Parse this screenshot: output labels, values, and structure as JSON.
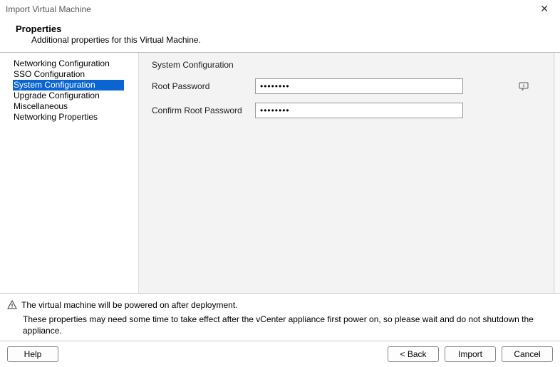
{
  "window": {
    "title": "Import Virtual Machine"
  },
  "header": {
    "title": "Properties",
    "subtitle": "Additional properties for this Virtual Machine."
  },
  "sidebar": {
    "items": [
      {
        "label": "Networking Configuration",
        "selected": false
      },
      {
        "label": "SSO Configuration",
        "selected": false
      },
      {
        "label": "System Configuration",
        "selected": true
      },
      {
        "label": "Upgrade Configuration",
        "selected": false
      },
      {
        "label": "Miscellaneous",
        "selected": false
      },
      {
        "label": "Networking Properties",
        "selected": false
      }
    ]
  },
  "content": {
    "section_title": "System Configuration",
    "root_password_label": "Root Password",
    "root_password_value": "••••••••",
    "confirm_root_password_label": "Confirm Root Password",
    "confirm_root_password_value": "••••••••"
  },
  "notice": {
    "line1": "The virtual machine will be powered on after deployment.",
    "line2": "These properties may need some time to take effect after the vCenter appliance first power on, so please wait and do not shutdown the appliance."
  },
  "buttons": {
    "help": "Help",
    "back": "< Back",
    "import": "Import",
    "cancel": "Cancel"
  }
}
